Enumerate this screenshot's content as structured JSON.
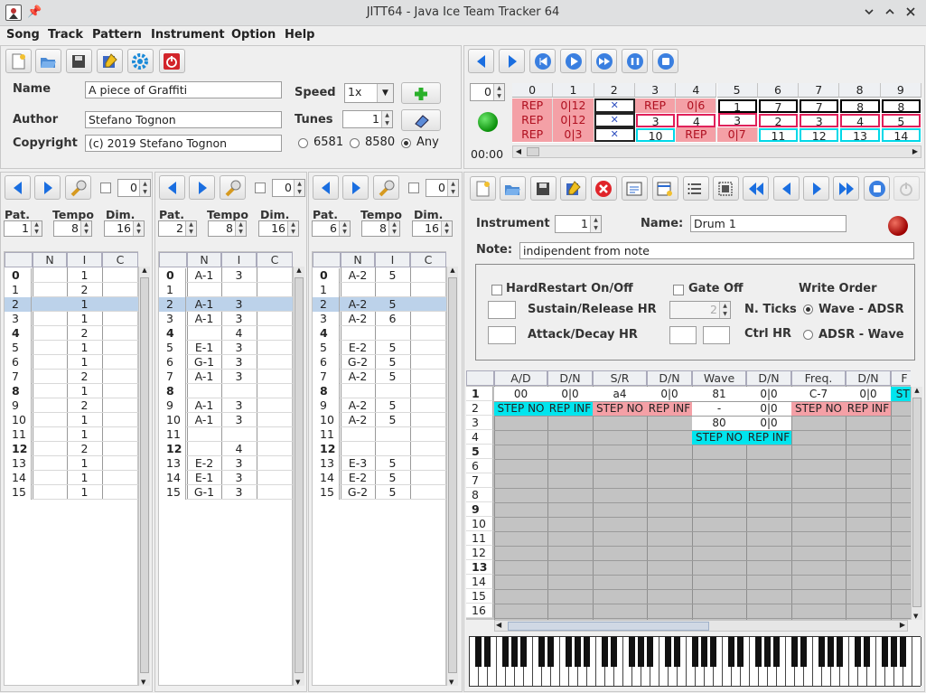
{
  "window": {
    "title": "JITT64 - Java Ice Team Tracker 64"
  },
  "menu": [
    "Song",
    "Track",
    "Pattern",
    "Instrument",
    "Option",
    "Help"
  ],
  "song": {
    "name_label": "Name",
    "name": "A piece of Graffiti",
    "author_label": "Author",
    "author": "Stefano Tognon",
    "copyright_label": "Copyright",
    "copyright": "(c) 2019 Stefano Tognon",
    "speed_label": "Speed",
    "speed": "1x",
    "tunes_label": "Tunes",
    "tunes": "1",
    "chips": [
      "6581",
      "8580",
      "Any"
    ],
    "chip_selected": "Any"
  },
  "order": {
    "headers": [
      "0",
      "1",
      "2",
      "3",
      "4",
      "5",
      "6",
      "7",
      "8",
      "9"
    ],
    "spinner": "0",
    "time": "00:00",
    "rows": [
      [
        "REP",
        "0|12",
        "✕",
        "REP",
        "0|6",
        "1",
        "7",
        "7",
        "8",
        "8"
      ],
      [
        "REP",
        "0|12",
        "✕",
        "3",
        "4",
        "3",
        "2",
        "3",
        "4",
        "5"
      ],
      [
        "REP",
        "0|3",
        "✕",
        "10",
        "REP",
        "0|7",
        "11",
        "12",
        "13",
        "14"
      ]
    ],
    "muted": [
      [],
      [],
      []
    ]
  },
  "tracks": [
    {
      "spinner": "0",
      "pat": "1",
      "tempo": "8",
      "dim": "16",
      "pat_label": "Pat.",
      "tempo_label": "Tempo",
      "dim_label": "Dim.",
      "cols": [
        "N",
        "I",
        "C"
      ],
      "rows": [
        [
          "0",
          "",
          "1",
          ""
        ],
        [
          "1",
          "",
          "2",
          ""
        ],
        [
          "2",
          "",
          "1",
          ""
        ],
        [
          "3",
          "",
          "1",
          ""
        ],
        [
          "4",
          "",
          "2",
          ""
        ],
        [
          "5",
          "",
          "1",
          ""
        ],
        [
          "6",
          "",
          "1",
          ""
        ],
        [
          "7",
          "",
          "2",
          ""
        ],
        [
          "8",
          "",
          "1",
          ""
        ],
        [
          "9",
          "",
          "2",
          ""
        ],
        [
          "10",
          "",
          "1",
          ""
        ],
        [
          "11",
          "",
          "1",
          ""
        ],
        [
          "12",
          "",
          "2",
          ""
        ],
        [
          "13",
          "",
          "1",
          ""
        ],
        [
          "14",
          "",
          "1",
          ""
        ],
        [
          "15",
          "",
          "1",
          ""
        ]
      ]
    },
    {
      "spinner": "0",
      "pat": "2",
      "tempo": "8",
      "dim": "16",
      "pat_label": "Pat.",
      "tempo_label": "Tempo",
      "dim_label": "Dim.",
      "cols": [
        "N",
        "I",
        "C"
      ],
      "rows": [
        [
          "0",
          "A-1",
          "3",
          ""
        ],
        [
          "1",
          "",
          "",
          ""
        ],
        [
          "2",
          "A-1",
          "3",
          ""
        ],
        [
          "3",
          "A-1",
          "3",
          ""
        ],
        [
          "4",
          "",
          "4",
          ""
        ],
        [
          "5",
          "E-1",
          "3",
          ""
        ],
        [
          "6",
          "G-1",
          "3",
          ""
        ],
        [
          "7",
          "A-1",
          "3",
          ""
        ],
        [
          "8",
          "",
          "",
          ""
        ],
        [
          "9",
          "A-1",
          "3",
          ""
        ],
        [
          "10",
          "A-1",
          "3",
          ""
        ],
        [
          "11",
          "",
          "",
          ""
        ],
        [
          "12",
          "",
          "4",
          ""
        ],
        [
          "13",
          "E-2",
          "3",
          ""
        ],
        [
          "14",
          "E-1",
          "3",
          ""
        ],
        [
          "15",
          "G-1",
          "3",
          ""
        ]
      ]
    },
    {
      "spinner": "0",
      "pat": "6",
      "tempo": "8",
      "dim": "16",
      "pat_label": "Pat.",
      "tempo_label": "Tempo",
      "dim_label": "Dim.",
      "cols": [
        "N",
        "I",
        "C"
      ],
      "rows": [
        [
          "0",
          "A-2",
          "5",
          ""
        ],
        [
          "1",
          "",
          "",
          ""
        ],
        [
          "2",
          "A-2",
          "5",
          ""
        ],
        [
          "3",
          "A-2",
          "6",
          ""
        ],
        [
          "4",
          "",
          "",
          ""
        ],
        [
          "5",
          "E-2",
          "5",
          ""
        ],
        [
          "6",
          "G-2",
          "5",
          ""
        ],
        [
          "7",
          "A-2",
          "5",
          ""
        ],
        [
          "8",
          "",
          "",
          ""
        ],
        [
          "9",
          "A-2",
          "5",
          ""
        ],
        [
          "10",
          "A-2",
          "5",
          ""
        ],
        [
          "11",
          "",
          "",
          ""
        ],
        [
          "12",
          "",
          "",
          ""
        ],
        [
          "13",
          "E-3",
          "5",
          ""
        ],
        [
          "14",
          "E-2",
          "5",
          ""
        ],
        [
          "15",
          "G-2",
          "5",
          ""
        ]
      ]
    }
  ],
  "instrument": {
    "instrument_label": "Instrument",
    "number": "1",
    "name_label": "Name:",
    "name": "Drum 1",
    "note_label": "Note:",
    "note": "indipendent from note",
    "hard_restart": "HardRestart On/Off",
    "gate_off": "Gate Off",
    "write_order": "Write Order",
    "sustain_release": "Sustain/Release HR",
    "attack_decay": "Attack/Decay HR",
    "n_ticks": "N. Ticks",
    "n_ticks_value": "2",
    "ctrl_hr": "Ctrl HR",
    "wave_adsr": "Wave - ADSR",
    "adsr_wave": "ADSR - Wave"
  },
  "inst_table": {
    "headers": [
      "A/D",
      "D/N",
      "S/R",
      "D/N",
      "Wave",
      "D/N",
      "Freq.",
      "D/N",
      "F"
    ],
    "rows": [
      [
        "00",
        "0|0",
        "a4",
        "0|0",
        "81",
        "0|0",
        "C-7",
        "0|0",
        "STI"
      ],
      [
        "STEP NO",
        "REP INF",
        "STEP NO",
        "REP INF",
        "-",
        "0|0",
        "STEP NO",
        "REP INF",
        ""
      ],
      [
        "",
        "",
        "",
        "",
        "80",
        "0|0",
        "",
        "",
        ""
      ],
      [
        "",
        "",
        "",
        "",
        "STEP NO",
        "REP INF",
        "",
        "",
        ""
      ]
    ],
    "row_numbers": [
      "1",
      "2",
      "3",
      "4",
      "5",
      "6",
      "7",
      "8",
      "9",
      "10",
      "11",
      "12",
      "13",
      "14",
      "15",
      "16"
    ]
  },
  "colors": {
    "pink": "#f4a0a6",
    "cyan": "#00e5ee",
    "red_border": "#e0205a",
    "cyan_border": "#00d8e8",
    "selected": "#bcd2ea",
    "grid": "#c4c4c4"
  }
}
